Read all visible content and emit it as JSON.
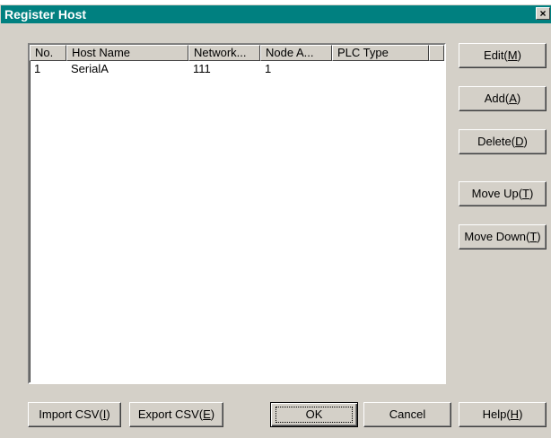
{
  "window": {
    "title": "Register Host",
    "close_glyph": "×"
  },
  "list": {
    "columns": [
      "No.",
      "Host Name",
      "Network...",
      "Node A...",
      "PLC Type"
    ],
    "rows": [
      [
        "1",
        "SerialA",
        "111",
        "1",
        ""
      ]
    ]
  },
  "side_buttons": {
    "edit": {
      "pre": "Edit(",
      "key": "M",
      "post": ")"
    },
    "add": {
      "pre": "Add(",
      "key": "A",
      "post": ")"
    },
    "delete": {
      "pre": "Delete(",
      "key": "D",
      "post": ")"
    },
    "move_up": {
      "pre": "Move Up(",
      "key": "T",
      "post": ")"
    },
    "move_down": {
      "pre": "Move Down(",
      "key": "T",
      "post": ")"
    }
  },
  "bottom_buttons": {
    "import_csv": {
      "pre": "Import CSV(",
      "key": "I",
      "post": ")"
    },
    "export_csv": {
      "pre": "Export CSV(",
      "key": "E",
      "post": ")"
    },
    "ok": "OK",
    "cancel": "Cancel",
    "help": {
      "pre": "Help(",
      "key": "H",
      "post": ")"
    }
  }
}
